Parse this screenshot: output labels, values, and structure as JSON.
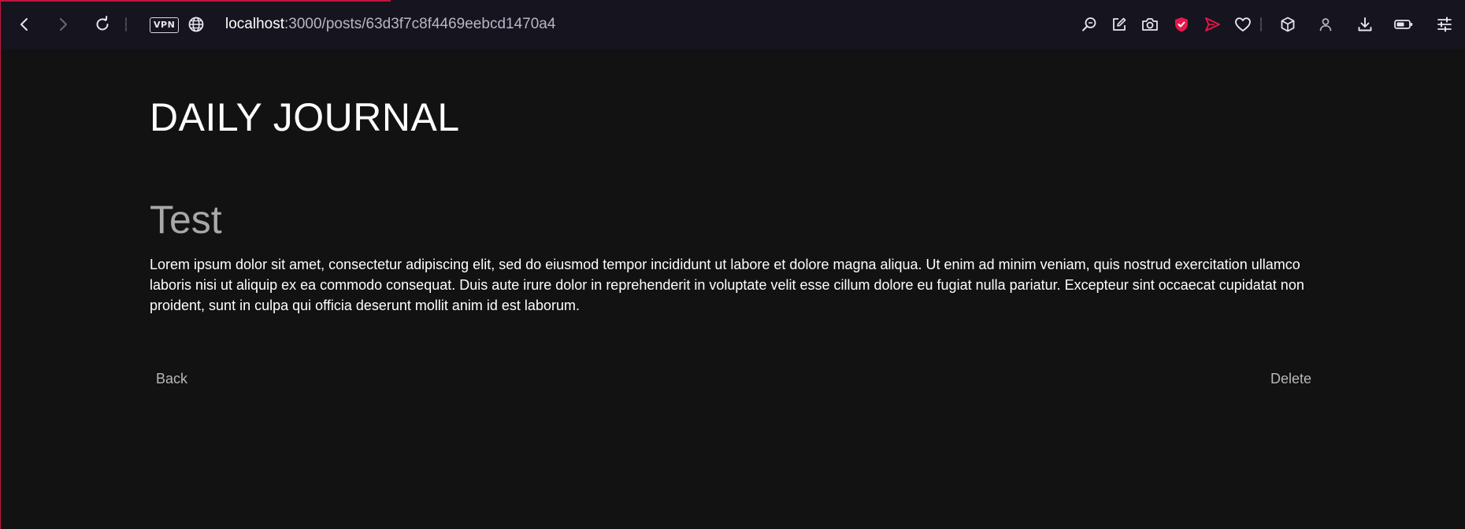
{
  "browser": {
    "address_bar": {
      "host": "localhost",
      "path": ":3000/posts/63d3f7c8f4469eebcd1470a4"
    },
    "vpn_label": "VPN",
    "toolbar_icons_left": [
      "back-arrow-icon",
      "forward-arrow-icon",
      "reload-icon",
      "vpn-badge",
      "globe-icon"
    ],
    "toolbar_icons_right": [
      "search-zoom-icon",
      "snapshot-edit-icon",
      "camera-icon",
      "shield-icon",
      "send-icon",
      "heart-icon",
      "cube-icon",
      "profile-icon",
      "download-icon",
      "battery-icon",
      "settings-sliders-icon"
    ],
    "accent_color": "#e8174a"
  },
  "page": {
    "brand": "DAILY JOURNAL",
    "post": {
      "title": "Test",
      "body": "Lorem ipsum dolor sit amet, consectetur adipiscing elit, sed do eiusmod tempor incididunt ut labore et dolore magna aliqua. Ut enim ad minim veniam, quis nostrud exercitation ullamco laboris nisi ut aliquip ex ea commodo consequat. Duis aute irure dolor in reprehenderit in voluptate velit esse cillum dolore eu fugiat nulla pariatur. Excepteur sint occaecat cupidatat non proident, sunt in culpa qui officia deserunt mollit anim id est laborum."
    },
    "actions": {
      "back_label": "Back",
      "delete_label": "Delete"
    }
  }
}
